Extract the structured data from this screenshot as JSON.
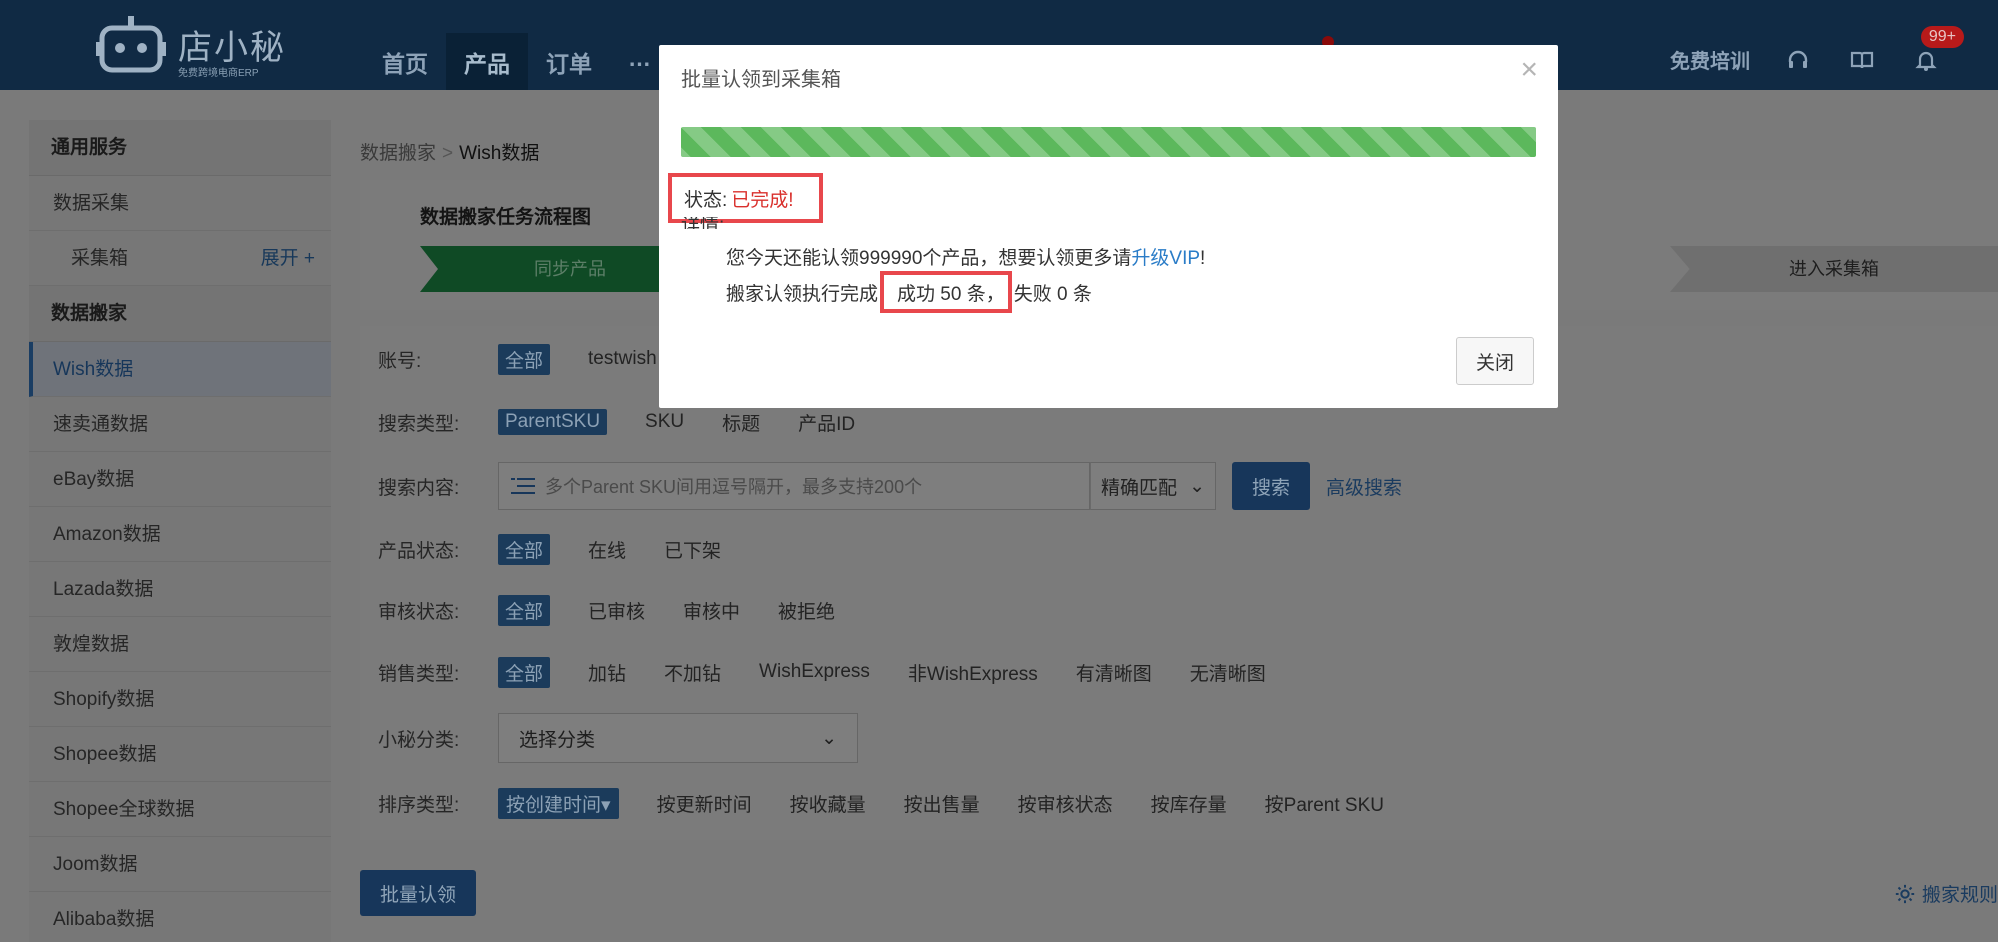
{
  "header": {
    "brand": "店小秘",
    "brand_sub": "免费跨境电商ERP",
    "nav": [
      "首页",
      "产品",
      "订单",
      "…"
    ],
    "free_training": "免费培训",
    "notifications_badge": "99+"
  },
  "sidebar": {
    "section1_title": "通用服务",
    "data_collect": "数据采集",
    "collect_box": "采集箱",
    "expand": "展开 +",
    "section2_title": "数据搬家",
    "items": [
      "Wish数据",
      "速卖通数据",
      "eBay数据",
      "Amazon数据",
      "Lazada数据",
      "敦煌数据",
      "Shopify数据",
      "Shopee数据",
      "Shopee全球数据",
      "Joom数据",
      "Alibaba数据"
    ]
  },
  "breadcrumb": {
    "parent": "数据搬家",
    "sep": ">",
    "current": "Wish数据"
  },
  "flow": {
    "title": "数据搬家任务流程图",
    "step1": "同步产品",
    "step4": "进入采集箱"
  },
  "filters": {
    "account": {
      "label": "账号:",
      "all": "全部",
      "value": "testwish"
    },
    "search_type": {
      "label": "搜索类型:",
      "options": [
        "ParentSKU",
        "SKU",
        "标题",
        "产品ID"
      ]
    },
    "search_content": {
      "label": "搜索内容:",
      "placeholder": "多个Parent SKU间用逗号隔开，最多支持200个",
      "match": "精确匹配",
      "search_btn": "搜索",
      "advanced": "高级搜索"
    },
    "product_status": {
      "label": "产品状态:",
      "options": [
        "全部",
        "在线",
        "已下架"
      ]
    },
    "review_status": {
      "label": "审核状态:",
      "options": [
        "全部",
        "已审核",
        "审核中",
        "被拒绝"
      ]
    },
    "sales_type": {
      "label": "销售类型:",
      "options": [
        "全部",
        "加钻",
        "不加钻",
        "WishExpress",
        "非WishExpress",
        "有清晰图",
        "无清晰图"
      ]
    },
    "category": {
      "label": "小秘分类:",
      "placeholder": "选择分类"
    },
    "sort": {
      "label": "排序类型:",
      "options": [
        "按创建时间",
        "按更新时间",
        "按收藏量",
        "按出售量",
        "按审核状态",
        "按库存量",
        "按Parent SKU"
      ]
    }
  },
  "actions": {
    "batch_claim": "批量认领",
    "rules": "搬家规则"
  },
  "modal": {
    "title": "批量认领到采集箱",
    "close_x": "×",
    "progress": 1.0,
    "status_label": "状态:",
    "status_value": "已完成!",
    "detail_label": "详情:",
    "line1_prefix": "您今天还能认领999990个产品，想要认领更多请",
    "line1_link": "升级VIP",
    "line1_suffix": "!",
    "line2_prefix": "搬家认领执行完成",
    "line2_success": "成功 50 条，",
    "line2_fail": "失败 0 条",
    "close_btn": "关闭"
  },
  "colors": {
    "progress": "#5cb85c",
    "highlight_box": "#e8474c",
    "status_value": "#d9302c",
    "link": "#2a7cc7"
  }
}
